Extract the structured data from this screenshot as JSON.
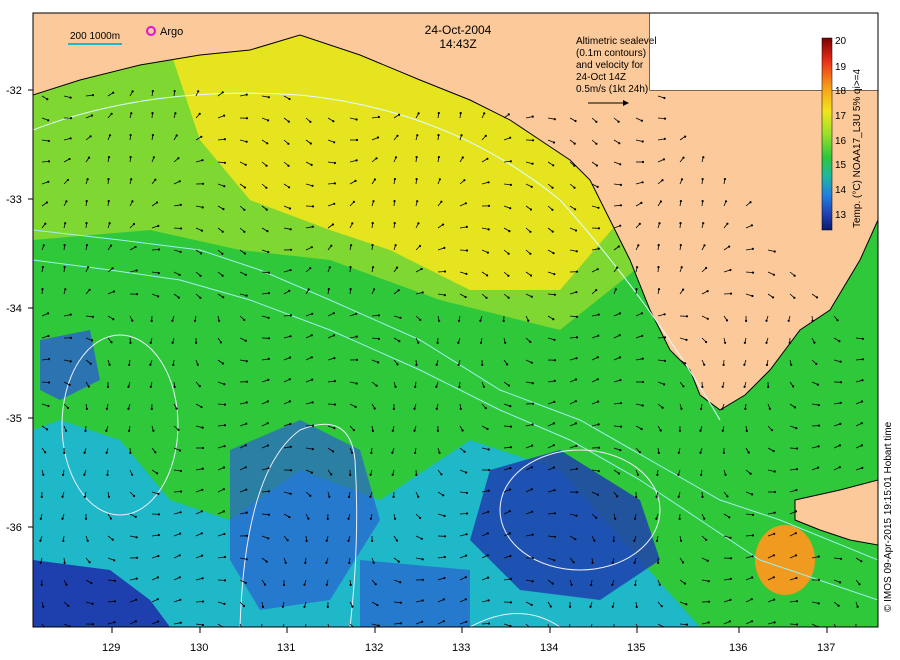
{
  "header": {
    "date": "24-Oct-2004",
    "time": "14:43Z"
  },
  "bathymetry_legend": {
    "label": "200  1000m"
  },
  "argo_legend": {
    "label": "Argo"
  },
  "velocity_note": {
    "lines": [
      "Altimetric sealevel",
      "(0.1m contours)",
      "and velocity for",
      "24-Oct 14Z",
      "0.5m/s (1kt 24h)"
    ]
  },
  "colorbar": {
    "label": "Temp. (°C) NOAA17_L3U 5% qi>=4",
    "ticks": [
      "20",
      "19",
      "18",
      "17",
      "16",
      "15",
      "14",
      "13"
    ],
    "range": [
      12.5,
      20
    ],
    "stops": [
      "#7a0000",
      "#e8301a",
      "#f79a1a",
      "#f2e41c",
      "#9be02a",
      "#2ec83a",
      "#1fb8a0",
      "#1f7fe0",
      "#1f3fb0",
      "#0a1a6e"
    ]
  },
  "axes": {
    "lat_ticks": [
      "-32",
      "-33",
      "-34",
      "-35",
      "-36"
    ],
    "lon_ticks": [
      "129",
      "130",
      "131",
      "132",
      "133",
      "134",
      "135",
      "136",
      "137"
    ]
  },
  "credit": "© IMOS 09-Apr-2015 19:15:01 Hobart time",
  "colors": {
    "land": "#fbc99a",
    "warm": "#f2e41c",
    "mid": "#2ec83a",
    "cool": "#1fb8c8",
    "deep": "#1e3fae"
  }
}
